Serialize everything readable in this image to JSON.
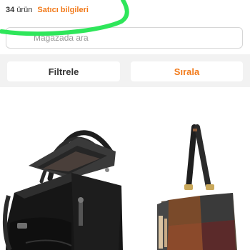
{
  "store": {
    "product_count_number": "34",
    "product_count_suffix": "ürün",
    "seller_info_label": "Satıcı bilgileri"
  },
  "search": {
    "placeholder": "Mağazada ara",
    "value": ""
  },
  "toolbar": {
    "filter_label": "Filtrele",
    "sort_label": "Sırala"
  },
  "products": [
    {
      "image": "black-leather-handbag"
    },
    {
      "image": "patchwork-leather-shoulder-bag"
    }
  ],
  "colors": {
    "accent": "#f27a1a",
    "annotation_stroke": "#2ee65a",
    "toolbar_background": "#f2f2f2"
  }
}
